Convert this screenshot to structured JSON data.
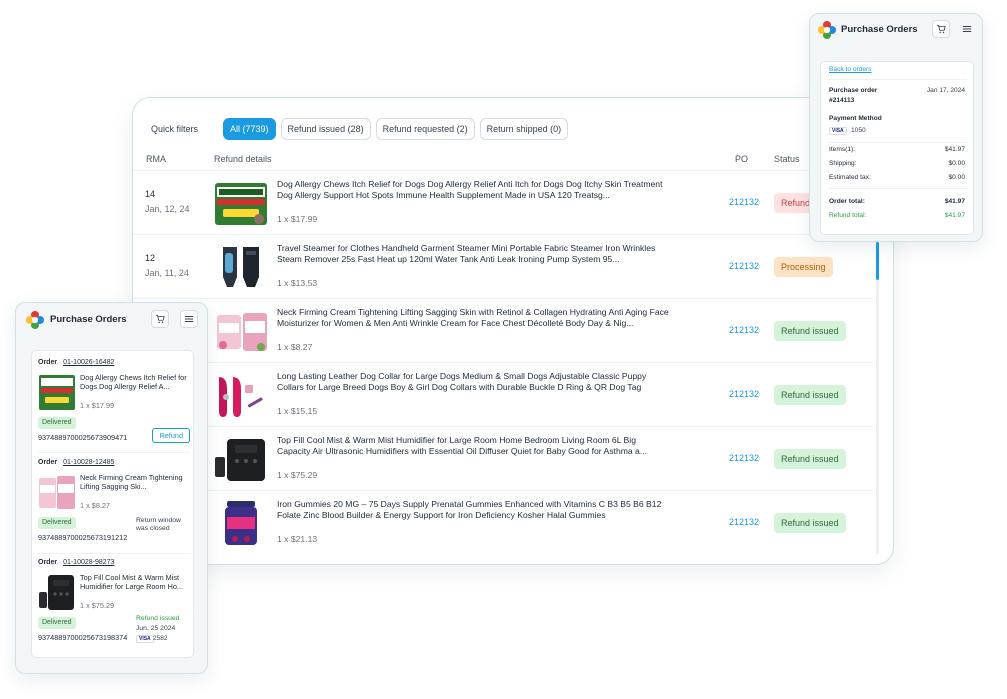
{
  "main": {
    "quick_filters_label": "Quick filters",
    "chips": [
      {
        "label": "All (7739)",
        "active": true
      },
      {
        "label": "Refund issued (28)",
        "active": false
      },
      {
        "label": "Refund requested (2)",
        "active": false
      },
      {
        "label": "Return shipped (0)",
        "active": false
      }
    ],
    "headers": {
      "rma": "RMA",
      "details": "Refund details",
      "po": "PO",
      "status": "Status"
    },
    "rows": [
      {
        "rma": "14",
        "date": "Jan, 12, 24",
        "title": "Dog Allergy Chews Itch Relief for Dogs Dog Allergy Relief Anti Itch for Dogs Dog Itchy Skin Treatment Dog Allergy Support Hot Spots Immune Health Supplement Made in USA 120 Treatsg...",
        "price": "1 x $17.99",
        "po": "212132",
        "status": "Refund",
        "status_type": "red"
      },
      {
        "rma": "12",
        "date": "Jan, 11, 24",
        "title": "Travel Steamer for Clothes Handheld Garment Steamer Mini Portable Fabric Steamer Iron Wrinkles Steam Remover 25s Fast Heat up 120ml Water Tank Anti Leak Ironing Pump System 95...",
        "price": "1 x $13.53",
        "po": "212132",
        "status": "Processing",
        "status_type": "orange"
      },
      {
        "rma": "",
        "date": "",
        "title": "Neck Firming Cream Tightening Lifting Sagging Skin with Retinol & Collagen Hydrating Anti Aging Face Moisturizer for Women & Men Anti Wrinkle Cream for Face Chest Décolleté Body Day & Nig...",
        "price": "1 x $8.27",
        "po": "212132",
        "status": "Refund issued",
        "status_type": "green"
      },
      {
        "rma": "",
        "date": "",
        "title": "Long Lasting Leather Dog Collar for Large Dogs Medium & Small Dogs Adjustable Classic Puppy Collars for Large Breed Dogs Boy & Girl Dog Collars with Durable Buckle D Ring & QR Dog Tag",
        "price": "1 x $15.15",
        "po": "212132",
        "status": "Refund issued",
        "status_type": "green"
      },
      {
        "rma": "",
        "date": "",
        "title": "Top Fill Cool Mist & Warm Mist Humidifier for Large Room Home Bedroom Living Room 6L Big Capacity Air Ultrasonic Humidifiers with Essential Oil Diffuser Quiet for Baby Good for Asthma a...",
        "price": "1 x $75.29",
        "po": "212132",
        "status": "Refund issued",
        "status_type": "green"
      },
      {
        "rma": "",
        "date": "",
        "title": "Iron Gummies 20 MG – 75 Days Supply Prenatal Gummies Enhanced with Vitamins C B3 B5 B6 B12 Folate Zinc Blood Builder & Energy Support for Iron Deficiency Kosher Halal Gummies",
        "price": "1 x $21.13",
        "po": "212132",
        "status": "Refund issued",
        "status_type": "green"
      }
    ]
  },
  "right_phone": {
    "app_title": "Purchase Orders",
    "back_link": "Back to orders",
    "purchase_order_label": "Purchase order",
    "purchase_order_number": "#214113",
    "date": "Jan 17, 2024",
    "payment_method_label": "Payment Method",
    "card_brand": "VISA",
    "card_last4": "1050",
    "items_label": "Items(1):",
    "items_value": "$41.97",
    "shipping_label": "Shipping:",
    "shipping_value": "$0.00",
    "tax_label": "Estimated tax:",
    "tax_value": "$0.00",
    "order_total_label": "Order total:",
    "order_total_value": "$41.97",
    "refund_total_label": "Refund total:",
    "refund_total_value": "$41.97"
  },
  "left_phone": {
    "app_title": "Purchase Orders",
    "orders": [
      {
        "label": "Order",
        "number": "01-10026-16482",
        "title": "Dog Allergy Chews Itch Relief for Dogs Dog Allergy Relief A...",
        "price": "1 x  $17.99",
        "status": "Delivered",
        "tracking": "9374889700025673909471",
        "action": "Refund"
      },
      {
        "label": "Order",
        "number": "01-10028-12485",
        "title": "Neck Firming Cream Tightening Lifting Sagging Ski...",
        "price": "1 x  $8.27",
        "status": "Delivered",
        "tracking": "9374889700025673191212",
        "note": "Return window was closed"
      },
      {
        "label": "Order",
        "number": "01-10028-98273",
        "title": "Top Fill Cool Mist & Warm Mist Humidifier for Large Room Ho...",
        "price": "1 x  $75.29",
        "status": "Delivered",
        "tracking": "9374889700025673198374",
        "refund_label": "Refund issued",
        "refund_date": "Jun, 25 2024",
        "card_brand": "VISA",
        "card_last4": "2582"
      }
    ]
  },
  "colors": {
    "accent": "#1a9ae0",
    "green_bg": "#d5f3d9",
    "green_text": "#2f6b3a",
    "orange_bg": "#fde3c3",
    "red_bg": "#fde2e2"
  },
  "icons": [
    "logo-icon",
    "cart-icon",
    "menu-icon",
    "visa-icon"
  ]
}
